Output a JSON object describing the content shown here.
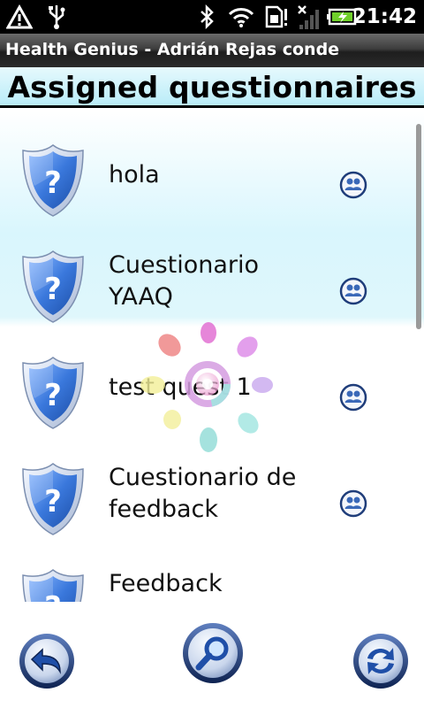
{
  "status_bar": {
    "time": "21:42",
    "icons": [
      "warning-icon",
      "usb-icon",
      "bluetooth-icon",
      "wifi-icon",
      "sim-icon",
      "signal-icon",
      "battery-charging-icon"
    ]
  },
  "app_title": "Health Genius - Adrián Rejas conde",
  "page_heading": "Assigned questionnaires",
  "questionnaires": [
    {
      "title_lines": [
        "hola"
      ],
      "icon": "question-shield-icon",
      "action_icon": "group-icon"
    },
    {
      "title_lines": [
        "Cuestionario",
        "YAAQ"
      ],
      "icon": "question-shield-icon",
      "action_icon": "group-icon"
    },
    {
      "title_lines": [
        "test quest 1"
      ],
      "icon": "question-shield-icon",
      "action_icon": "group-icon"
    },
    {
      "title_lines": [
        "Cuestionario de",
        "feedback"
      ],
      "icon": "question-shield-icon",
      "action_icon": "group-icon"
    },
    {
      "title_lines": [
        "Feedback"
      ],
      "icon": "question-shield-icon",
      "action_icon": ""
    }
  ],
  "toolbar": {
    "buttons": [
      "back-arrow-icon",
      "search-magnifier-icon",
      "refresh-icon"
    ]
  },
  "loading_indicator": "loading-spinner",
  "colors": {
    "header_gradient_top": "#e6f9fd",
    "header_gradient_bottom": "#b9ecf8",
    "shield_blue": "#2f6fd0",
    "button_blue": "#2a4f9c"
  }
}
